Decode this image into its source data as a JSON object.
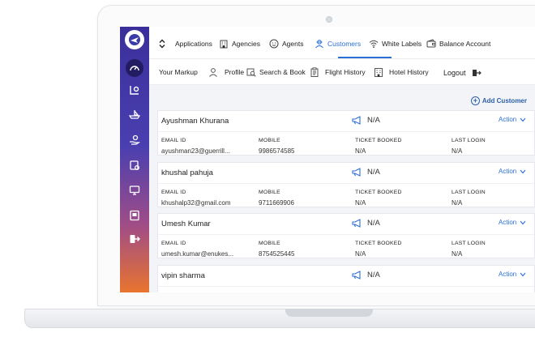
{
  "nav": {
    "items": [
      {
        "label": "Applications",
        "icon": "chevron-updown-icon"
      },
      {
        "label": "Agencies",
        "icon": "building-icon"
      },
      {
        "label": "Agents",
        "icon": "agent-face-icon"
      },
      {
        "label": "Customers",
        "icon": "customer-icon",
        "active": true
      },
      {
        "label": "White Labels",
        "icon": "wifi-icon"
      },
      {
        "label": "Balance Account",
        "icon": "wallet-icon"
      }
    ],
    "sub_items": [
      {
        "label": "Your Markup",
        "icon": ""
      },
      {
        "label": "Profile",
        "icon": "profile-icon"
      },
      {
        "label": "Search & Book",
        "icon": "search-book-icon"
      },
      {
        "label": "Flight History",
        "icon": "clipboard-icon"
      },
      {
        "label": "Hotel History",
        "icon": "hotel-icon"
      },
      {
        "label": "Logout",
        "icon": "logout-icon"
      }
    ],
    "accent": "#2b6fd6"
  },
  "main": {
    "add_customer_label": "Add Customer",
    "columns": {
      "email": "EMAIL ID",
      "mobile": "MOBILE",
      "ticket": "TICKET BOOKED",
      "login": "LAST LOGIN"
    },
    "action_label": "Action",
    "customers": [
      {
        "name": "Ayushman Khurana",
        "phone_status": "N/A",
        "email": "ayushman23@guerrill...",
        "mobile": "9986574585",
        "ticket": "N/A",
        "last_login": "N/A"
      },
      {
        "name": "khushal pahuja",
        "phone_status": "N/A",
        "email": "khushalp32@gmail.com",
        "mobile": "9711669906",
        "ticket": "N/A",
        "last_login": "N/A"
      },
      {
        "name": "Umesh Kumar",
        "phone_status": "N/A",
        "email": "umesh.kumar@enukes...",
        "mobile": "8754525445",
        "ticket": "N/A",
        "last_login": "N/A"
      },
      {
        "name": "vipin sharma",
        "phone_status": "N/A",
        "email": "",
        "mobile": "",
        "ticket": "",
        "last_login": ""
      }
    ]
  },
  "sidebar": {
    "icons": [
      "speedometer-icon",
      "chart-settings-icon",
      "boat-icon",
      "hand-money-icon",
      "settings-doc-icon",
      "monitor-icon",
      "id-card-icon",
      "logout-icon"
    ],
    "gradient": [
      "#3a2f9a",
      "#e8742e"
    ]
  }
}
